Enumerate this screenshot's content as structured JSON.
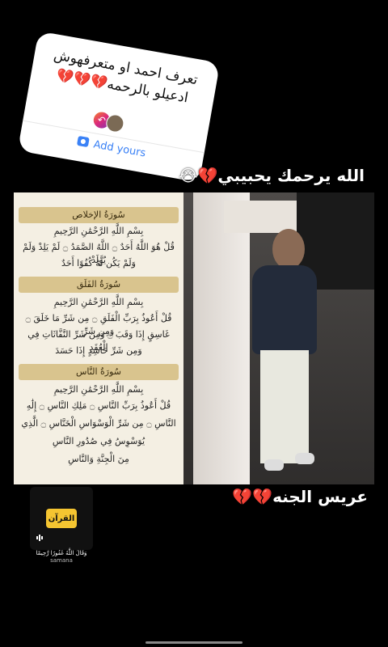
{
  "sticker": {
    "question_line1": "تعرف احمد او متعرفهوش",
    "question_line2": "ادعيلو بالرحمه💔💔💔",
    "add_label": "Add yours"
  },
  "caption_top": "الله يرحمك يحبيبي💔😭",
  "caption_bottom": "عريس الجنه💔💔",
  "quran": {
    "ikhlas_title": "سُورَةُ الإخلاص",
    "ikhlas_basmala": "بِسْمِ اللَّهِ الرَّحْمَٰنِ الرَّحِيمِ",
    "ikhlas_v1": "قُلْ هُوَ اللَّهُ أَحَدٌ ۝ اللَّهُ الصَّمَدُ ۝ لَمْ يَلِدْ وَلَمْ يُولَدْ",
    "ikhlas_v2": "وَلَمْ يَكُن لَّهُ كُفُوًا أَحَدٌ",
    "falaq_title": "سُورَةُ الفَلَق",
    "falaq_basmala": "بِسْمِ اللَّهِ الرَّحْمَٰنِ الرَّحِيمِ",
    "falaq_v1": "قُلْ أَعُوذُ بِرَبِّ الْفَلَقِ ۝ مِن شَرِّ مَا خَلَقَ ۝ وَمِن شَرِّ",
    "falaq_v2": "غَاسِقٍ إِذَا وَقَبَ ۝ وَمِن شَرِّ النَّفَّاثَاتِ فِي الْعُقَدِ",
    "falaq_v3": "وَمِن شَرِّ حَاسِدٍ إِذَا حَسَدَ",
    "nas_title": "سُورَةُ النَّاس",
    "nas_basmala": "بِسْمِ اللَّهِ الرَّحْمَٰنِ الرَّحِيمِ",
    "nas_v1": "قُلْ أَعُوذُ بِرَبِّ النَّاسِ ۝ مَلِكِ النَّاسِ ۝ إِلَٰهِ",
    "nas_v2": "النَّاسِ ۝ مِن شَرِّ الْوَسْوَاسِ الْخَنَّاسِ ۝ الَّذِي",
    "nas_v3": "يُوَسْوِسُ فِي صُدُورِ النَّاسِ",
    "nas_v4": "مِنَ الْجِنَّةِ وَالنَّاسِ"
  },
  "music": {
    "badge": "القرآن",
    "title": "وَقَالَ اللَّهُ غَفُورًا رَّحِيمًا",
    "artist": "samana"
  },
  "colors": {
    "background": "#000000",
    "sticker_link": "#3b82f6",
    "quran_header": "#d9c48e"
  }
}
